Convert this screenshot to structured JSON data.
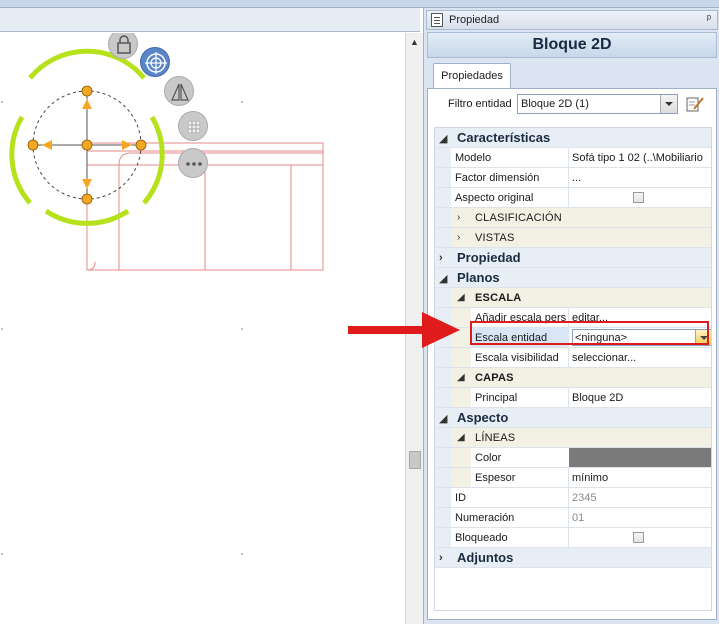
{
  "panel": {
    "title": "Propiedad",
    "pin": "ᵖ",
    "header": "Bloque 2D",
    "tab": "Propiedades",
    "filter": {
      "label": "Filtro entidad",
      "value": "Bloque 2D (1)"
    }
  },
  "grid": {
    "caracteristicas": {
      "label": "Características",
      "rows": [
        {
          "name": "Modelo",
          "value": "Sofá tipo 1 02   (..\\Mobiliario"
        },
        {
          "name": "Factor dimensión",
          "value": "..."
        },
        {
          "name": "Aspecto original",
          "value": ""
        }
      ],
      "clasificacion": "CLASIFICACIÓN",
      "vistas": "VISTAS"
    },
    "propiedad": {
      "label": "Propiedad"
    },
    "planos": {
      "label": "Planos",
      "escala": {
        "label": "ESCALA",
        "rows": [
          {
            "name": "Añadir escala pers",
            "value": "editar..."
          },
          {
            "name": "Escala entidad",
            "value": "<ninguna>"
          },
          {
            "name": "Escala visibilidad",
            "value": "seleccionar..."
          }
        ]
      },
      "capas": {
        "label": "CAPAS",
        "rows": [
          {
            "name": "Principal",
            "value": "Bloque 2D"
          }
        ]
      }
    },
    "aspecto": {
      "label": "Aspecto",
      "lineas": {
        "label": "LÍNEAS",
        "rows": [
          {
            "name": "Color",
            "value": ""
          },
          {
            "name": "Espesor",
            "value": "mínimo"
          }
        ]
      },
      "rows": [
        {
          "name": "ID",
          "value": "2345"
        },
        {
          "name": "Numeración",
          "value": "01"
        },
        {
          "name": "Bloqueado",
          "value": ""
        }
      ]
    },
    "adjuntos": {
      "label": "Adjuntos"
    }
  },
  "colors": {
    "highlight": "#e01b1b",
    "gizmo_ring": "#b6e21c",
    "gizmo_handle": "#f5a623",
    "drawing_line": "#e88a8a",
    "line_color_swatch": "#7a7a7a"
  }
}
